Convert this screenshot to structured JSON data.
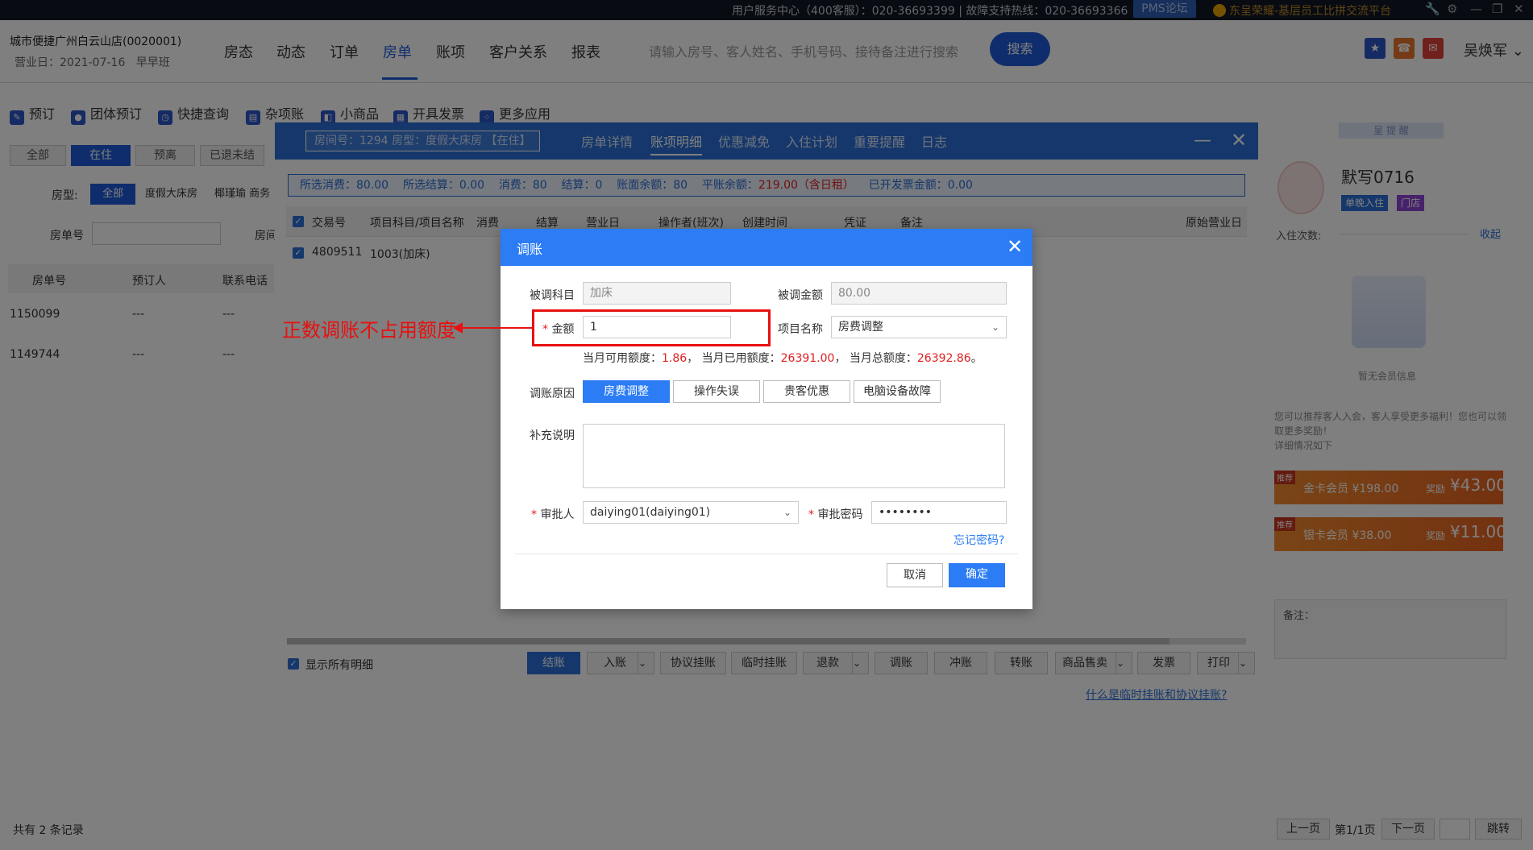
{
  "topbar": {
    "service_text": "用户服务中心（400客服）：020-36693399 | 故障支持热线：020-36693366",
    "pms_forum": "PMS论坛",
    "forum_text": "东呈荣耀-基层员工比拼交流平台"
  },
  "header": {
    "hotel": "城市便捷广州白云山店(0020001)",
    "biz_date": "营业日：2021-07-16",
    "shift": "早早班",
    "nav": [
      "房态",
      "动态",
      "订单",
      "房单",
      "账项",
      "客户关系",
      "报表"
    ],
    "active_nav": "房单",
    "search_placeholder": "请输入房号、客人姓名、手机号码、接待备注进行搜索",
    "search_btn": "搜索",
    "user": "吴焕军"
  },
  "toolbar": [
    "预订",
    "团体预订",
    "快捷查询",
    "杂项账",
    "小商品",
    "开具发票",
    "更多应用"
  ],
  "left": {
    "filter_tabs": [
      "全部",
      "在住",
      "预离",
      "已退未结"
    ],
    "room_type_label": "房型:",
    "room_types": [
      "全部",
      "度假大床房",
      "椰瑾瑜 商务"
    ],
    "room_no_label": "房单号",
    "room_label_2": "房间",
    "columns": [
      "房单号",
      "预订人",
      "联系电话"
    ],
    "rows": [
      {
        "no": "1150099",
        "booker": "---",
        "phone": "---"
      },
      {
        "no": "1149744",
        "booker": "---",
        "phone": "---"
      }
    ]
  },
  "drawer": {
    "room_info": "房间号：1294 房型：度假大床房 【在住】",
    "tabs": [
      "房单详情",
      "账项明细",
      "优惠减免",
      "入住计划",
      "重要提醒",
      "日志"
    ],
    "active_tab": "账项明细",
    "summary": {
      "sel_consume_label": "所选消费：",
      "sel_consume": "80.00",
      "sel_settle_label": "所选结算：",
      "sel_settle": "0.00",
      "consume_label": "消费：",
      "consume": "80",
      "settle_label": "结算：",
      "settle": "0",
      "balance_label": "账面余额：",
      "balance": "80",
      "flat_balance_label": "平账余额：",
      "flat_balance": "219.00（含日租）",
      "invoiced_label": "已开发票金额：",
      "invoiced": "0.00"
    },
    "columns": [
      "交易号",
      "项目科目/项目名称",
      "消费",
      "结算",
      "营业日",
      "操作者(班次)",
      "创建时间",
      "凭证",
      "备注",
      "原始营业日"
    ],
    "row": {
      "txn": "4809511",
      "item": "1003(加床)"
    },
    "show_all": "显示所有明细",
    "actions": [
      "结账",
      "入账",
      "协议挂账",
      "临时挂账",
      "退款",
      "调账",
      "冲账",
      "转账",
      "商品售卖",
      "发票",
      "打印"
    ],
    "help_link": "什么是临时挂账和协议挂账?"
  },
  "right_panel": {
    "header": "呈 提 醒",
    "name": "默写0716",
    "tag1": "单晚入住",
    "tag2": "门店",
    "stay_label": "入住次数:",
    "fold": "收起",
    "empty": "暂无会员信息",
    "tip": "您可以推荐客人入会，客人享受更多福利！您也可以领取更多奖励！",
    "tip_detail": "详细情况如下",
    "cards": [
      {
        "badge": "推荐",
        "name": "金卡会员 ¥198.00",
        "reward_label": "奖励",
        "reward": "¥43.00"
      },
      {
        "badge": "推荐",
        "name": "银卡会员 ¥38.00",
        "reward_label": "奖励",
        "reward": "¥11.00"
      }
    ],
    "note_label": "备注："
  },
  "bottom": {
    "total": "共有 2 条记录",
    "prev": "上一页",
    "page": "第1/1页",
    "next": "下一页",
    "jump": "跳转"
  },
  "modal": {
    "title": "调账",
    "adj_item_label": "被调科目",
    "adj_item": "加床",
    "adj_amount_label": "被调金额",
    "adj_amount": "80.00",
    "amount_label": "金额",
    "amount": "1",
    "item_name_label": "项目名称",
    "item_name": "房费调整",
    "quota_avail_label": "当月可用额度：",
    "quota_avail": "1.86",
    "quota_used_label": "，  当月已用额度：",
    "quota_used": "26391.00",
    "quota_total_label": "，  当月总额度：",
    "quota_total": "26392.86",
    "quota_end": "。",
    "reason_label": "调账原因",
    "reasons": [
      "房费调整",
      "操作失误",
      "贵客优惠",
      "电脑设备故障"
    ],
    "active_reason": "房费调整",
    "remark_label": "补充说明",
    "approver_label": "审批人",
    "approver": "daiying01(daiying01)",
    "password_label": "审批密码",
    "password": "••••••••",
    "forgot": "忘记密码?",
    "cancel": "取消",
    "confirm": "确定"
  },
  "annotation": "正数调账不占用额度"
}
